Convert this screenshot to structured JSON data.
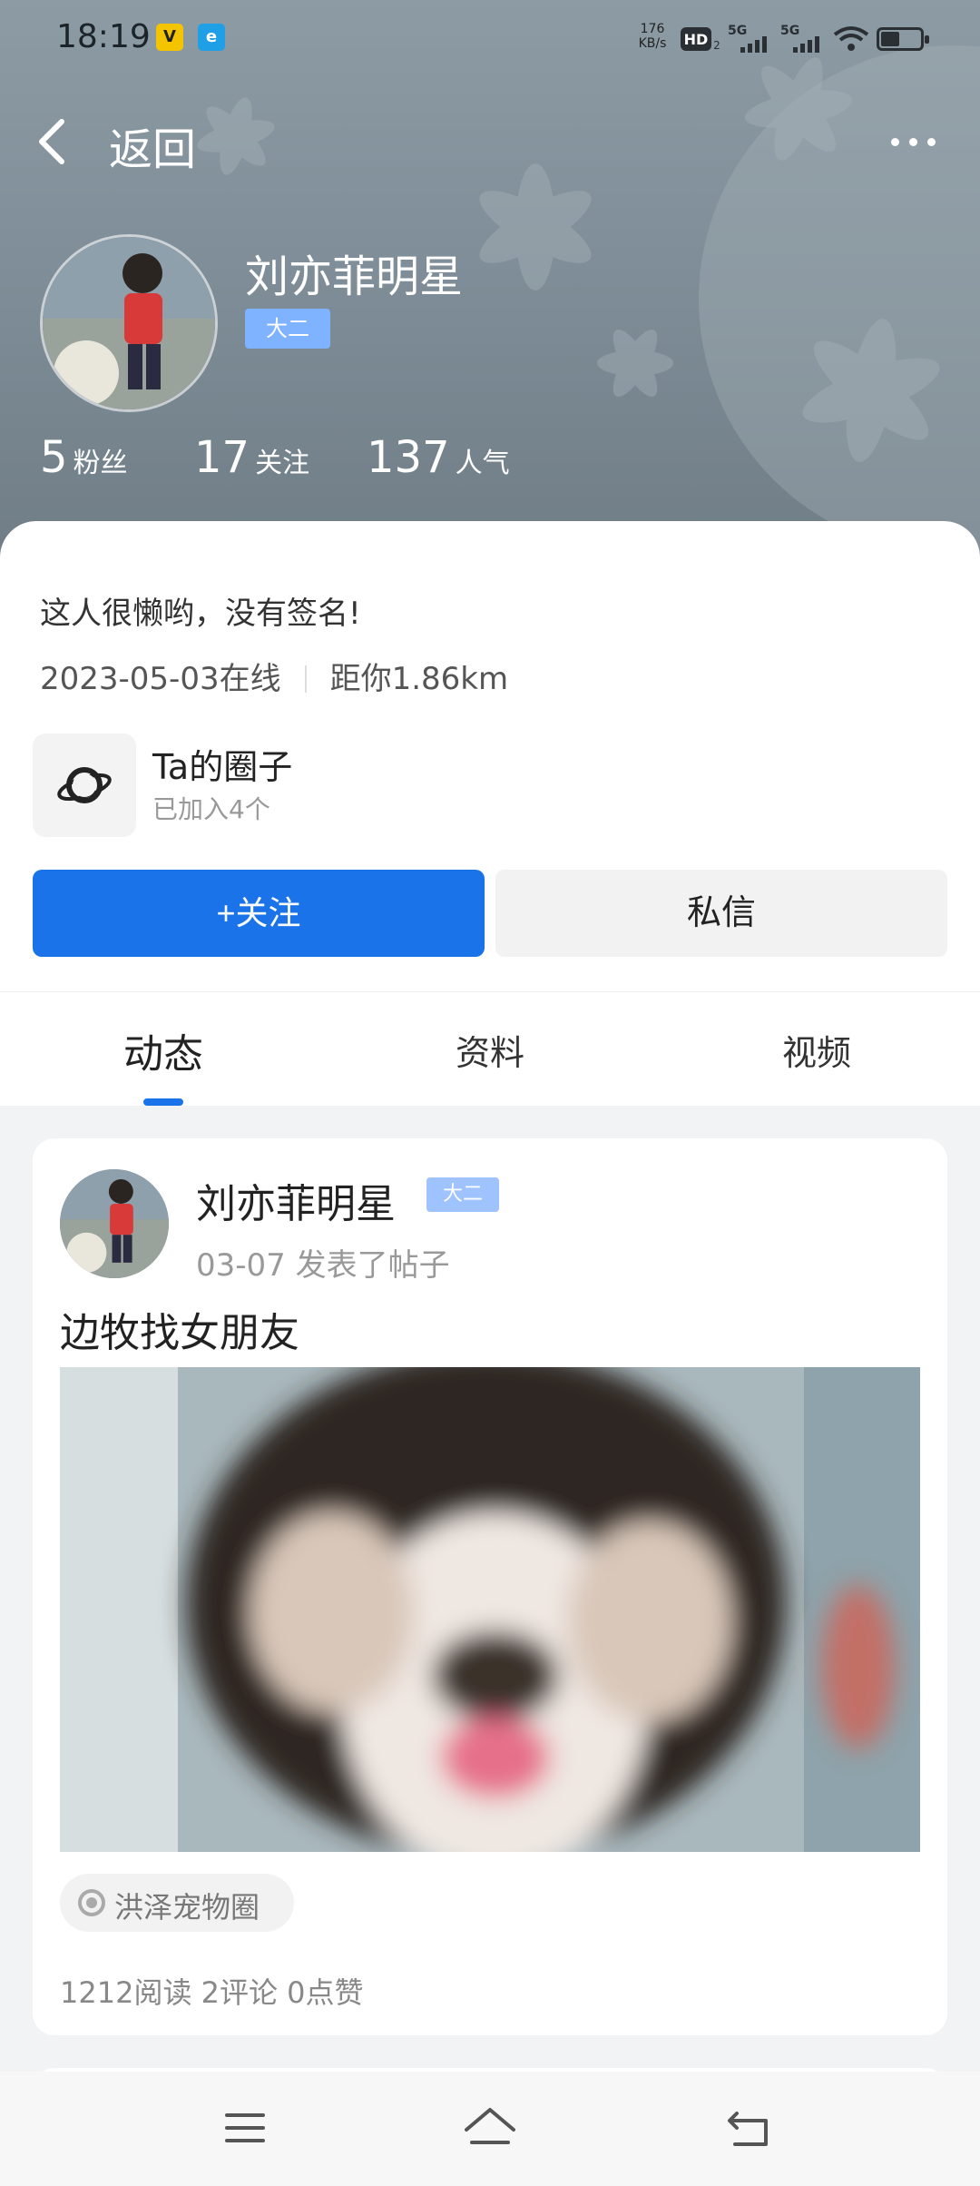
{
  "status_bar": {
    "time": "18:19",
    "speed_top": "176",
    "speed_unit": "KB/s",
    "hd": "HD",
    "network1": "5G",
    "network2": "5G",
    "app_icon_1": "V",
    "app_icon_2": "e"
  },
  "nav": {
    "back_label": "返回",
    "more": "more-icon"
  },
  "profile": {
    "name": "刘亦菲明星",
    "grade": "大二",
    "stats": [
      {
        "num": "5",
        "label": "粉丝"
      },
      {
        "num": "17",
        "label": "关注"
      },
      {
        "num": "137",
        "label": "人气"
      }
    ],
    "signature": "这人很懒哟，没有签名!",
    "last_online": "2023-05-03在线",
    "distance": "距你1.86km"
  },
  "circle": {
    "title": "Ta的圈子",
    "subtitle": "已加入4个"
  },
  "actions": {
    "follow": "+关注",
    "message": "私信"
  },
  "tabs": [
    {
      "label": "动态",
      "active": true
    },
    {
      "label": "资料",
      "active": false
    },
    {
      "label": "视频",
      "active": false
    }
  ],
  "post": {
    "author": "刘亦菲明星",
    "badge": "大二",
    "date": "03-07",
    "action": "发表了帖子",
    "title": "边牧找女朋友",
    "tag": "洪泽宠物圈",
    "reads": "1212阅读",
    "comments": "2评论",
    "likes": "0点赞"
  },
  "colors": {
    "accent": "#1a73e8",
    "badge": "#7fb2ff",
    "header_bg": "#7f8e98"
  }
}
